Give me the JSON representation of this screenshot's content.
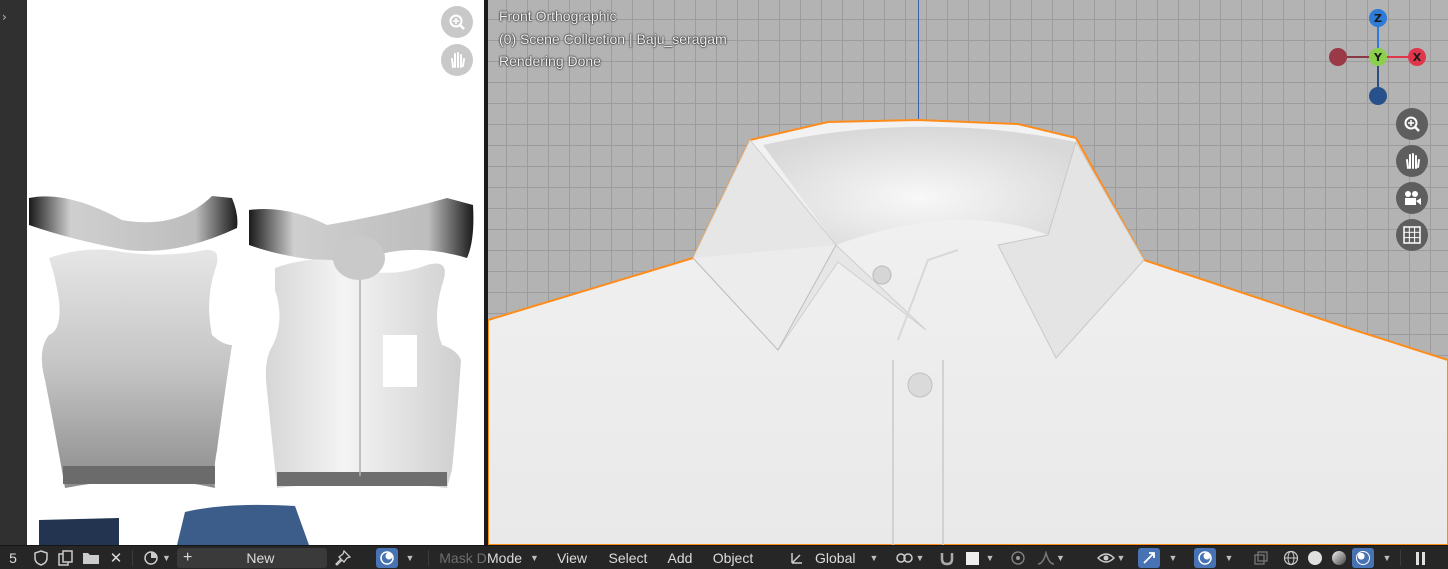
{
  "image_editor": {
    "frame_number": "5",
    "new_label": "New",
    "texture_colors": {
      "fabric": "#f0f0f0",
      "shade": "#888888",
      "dark": "#0d0d0d",
      "denim": "#3b5f8f"
    }
  },
  "viewport": {
    "view_name": "Front Orthographic",
    "collection": "(0) Scene Collection | Baju_seragam",
    "status": "Rendering Done",
    "selection_outline_color": "#ff8c1a",
    "gizmo": {
      "z_label": "Z",
      "y_label": "Y",
      "x_label": "X"
    }
  },
  "header": {
    "mode_overlap": "Mask D",
    "mode_label": "Mode",
    "menus": {
      "view": "View",
      "select": "Select",
      "add": "Add",
      "object": "Object"
    },
    "transform_orientation": "Global"
  },
  "colors": {
    "accent": "#4772b3",
    "x_axis": "#e0364b",
    "y_axis": "#8bd04a",
    "z_axis": "#2f7bd8"
  }
}
